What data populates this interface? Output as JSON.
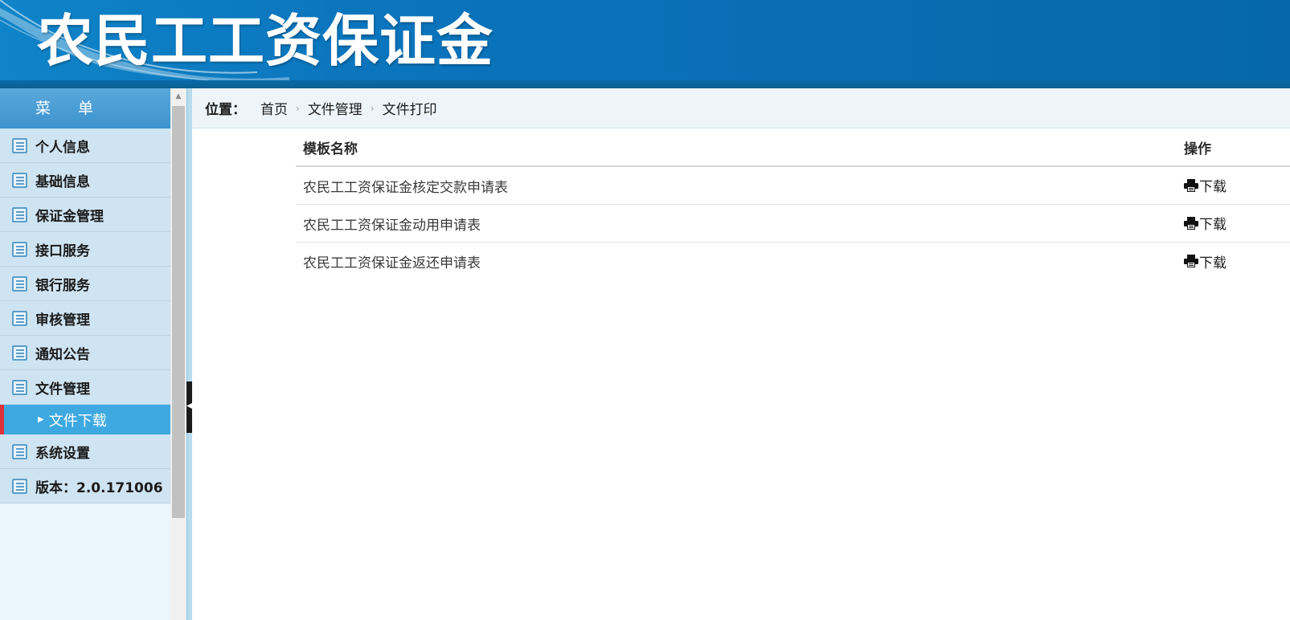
{
  "header": {
    "title": "农民工工资保证金"
  },
  "sidebar": {
    "menu_title": "菜 单",
    "items": [
      {
        "label": "个人信息",
        "icon": "list-icon"
      },
      {
        "label": "基础信息",
        "icon": "list-icon"
      },
      {
        "label": "保证金管理",
        "icon": "list-icon"
      },
      {
        "label": "接口服务",
        "icon": "list-icon"
      },
      {
        "label": "银行服务",
        "icon": "list-icon"
      },
      {
        "label": "审核管理",
        "icon": "list-icon"
      },
      {
        "label": "通知公告",
        "icon": "list-icon"
      },
      {
        "label": "文件管理",
        "icon": "list-icon"
      }
    ],
    "active_submenu": {
      "label": "文件下载"
    },
    "items_after": [
      {
        "label": "系统设置",
        "icon": "list-icon"
      },
      {
        "label": "版本：2.0.171006",
        "icon": "list-icon"
      }
    ]
  },
  "breadcrumb": {
    "prefix": "位置：",
    "items": [
      "首页",
      "文件管理",
      "文件打印"
    ]
  },
  "table": {
    "headers": {
      "name": "模板名称",
      "op": "操作"
    },
    "rows": [
      {
        "name": "农民工工资保证金核定交款申请表",
        "op": "下载"
      },
      {
        "name": "农民工工资保证金动用申请表",
        "op": "下载"
      },
      {
        "name": "农民工工资保证金返还申请表",
        "op": "下载"
      }
    ]
  },
  "colors": {
    "header_bg": "#0a6db3",
    "menu_item_bg": "#cfe4f2",
    "active_submenu_bg": "#3da9e0",
    "active_marker": "#e0323a",
    "breadcrumb_bg": "#edf5fb"
  }
}
